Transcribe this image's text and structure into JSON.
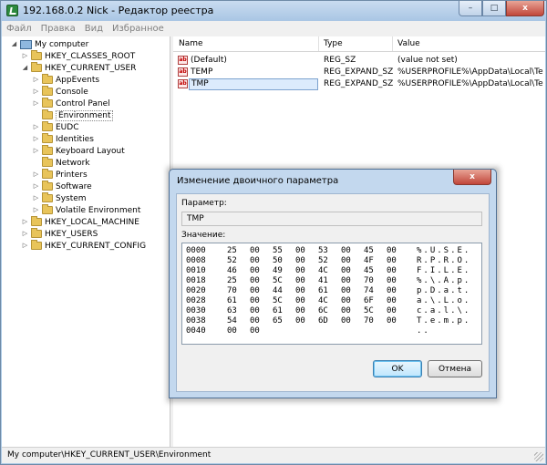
{
  "window": {
    "title": "192.168.0.2 Nick - Редактор реестра",
    "buttons": {
      "minimize": "–",
      "maximize": "□",
      "close": "x"
    }
  },
  "menu": [
    "Файл",
    "Правка",
    "Вид",
    "Избранное"
  ],
  "tree": {
    "root": "My computer",
    "hkcr": "HKEY_CLASSES_ROOT",
    "hkcu": "HKEY_CURRENT_USER",
    "hkcu_children": [
      "AppEvents",
      "Console",
      "Control Panel",
      "Environment",
      "EUDC",
      "Identities",
      "Keyboard Layout",
      "Network",
      "Printers",
      "Software",
      "System",
      "Volatile Environment"
    ],
    "selected": "Environment",
    "hklm": "HKEY_LOCAL_MACHINE",
    "hku": "HKEY_USERS",
    "hkcc": "HKEY_CURRENT_CONFIG"
  },
  "list": {
    "columns": [
      "Name",
      "Type",
      "Value"
    ],
    "rows": [
      {
        "name": "(Default)",
        "type": "REG_SZ",
        "value": "(value not set)"
      },
      {
        "name": "TEMP",
        "type": "REG_EXPAND_SZ",
        "value": "%USERPROFILE%\\AppData\\Local\\Temp"
      },
      {
        "name": "TMP",
        "type": "REG_EXPAND_SZ",
        "value": "%USERPROFILE%\\AppData\\Local\\Temp"
      }
    ],
    "icon_text": "ab"
  },
  "status": "My computer\\HKEY_CURRENT_USER\\Environment",
  "dialog": {
    "title": "Изменение двоичного параметра",
    "close": "x",
    "param_label": "Параметр:",
    "param_value": "TMP",
    "value_label": "Значение:",
    "hex": [
      {
        "offset": "0000",
        "bytes": [
          "25",
          "00",
          "55",
          "00",
          "53",
          "00",
          "45",
          "00"
        ],
        "ascii": "%.U.S.E."
      },
      {
        "offset": "0008",
        "bytes": [
          "52",
          "00",
          "50",
          "00",
          "52",
          "00",
          "4F",
          "00"
        ],
        "ascii": "R.P.R.O."
      },
      {
        "offset": "0010",
        "bytes": [
          "46",
          "00",
          "49",
          "00",
          "4C",
          "00",
          "45",
          "00"
        ],
        "ascii": "F.I.L.E."
      },
      {
        "offset": "0018",
        "bytes": [
          "25",
          "00",
          "5C",
          "00",
          "41",
          "00",
          "70",
          "00"
        ],
        "ascii": "%.\\.A.p."
      },
      {
        "offset": "0020",
        "bytes": [
          "70",
          "00",
          "44",
          "00",
          "61",
          "00",
          "74",
          "00"
        ],
        "ascii": "p.D.a.t."
      },
      {
        "offset": "0028",
        "bytes": [
          "61",
          "00",
          "5C",
          "00",
          "4C",
          "00",
          "6F",
          "00"
        ],
        "ascii": "a.\\.L.o."
      },
      {
        "offset": "0030",
        "bytes": [
          "63",
          "00",
          "61",
          "00",
          "6C",
          "00",
          "5C",
          "00"
        ],
        "ascii": "c.a.l.\\."
      },
      {
        "offset": "0038",
        "bytes": [
          "54",
          "00",
          "65",
          "00",
          "6D",
          "00",
          "70",
          "00"
        ],
        "ascii": "T.e.m.p."
      },
      {
        "offset": "0040",
        "bytes": [
          "00",
          "00"
        ],
        "ascii": ".."
      }
    ],
    "ok": "OK",
    "cancel": "Отмена"
  }
}
